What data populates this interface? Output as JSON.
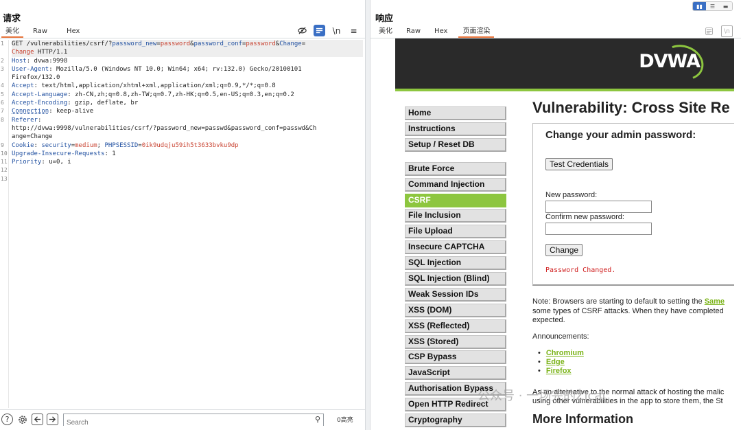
{
  "request": {
    "title": "请求",
    "tabs": [
      "美化",
      "Raw",
      "Hex"
    ],
    "active_tab": "美化",
    "toolbar": {
      "wrap_label": "\\n",
      "menu_label": "≡"
    },
    "lines": [
      {
        "n": "1",
        "parts": [
          {
            "t": "GET /vulnerabilities/csrf/?",
            "c": ""
          },
          {
            "t": "password_new",
            "c": "v"
          },
          {
            "t": "=",
            "c": ""
          },
          {
            "t": "password",
            "c": "p"
          },
          {
            "t": "&",
            "c": ""
          },
          {
            "t": "password_conf",
            "c": "v"
          },
          {
            "t": "=",
            "c": ""
          },
          {
            "t": "password",
            "c": "p"
          },
          {
            "t": "&",
            "c": ""
          },
          {
            "t": "Change",
            "c": "v"
          },
          {
            "t": "=",
            "c": ""
          }
        ]
      },
      {
        "n": "",
        "parts": [
          {
            "t": "Change",
            "c": "p"
          },
          {
            "t": " HTTP/1.1",
            "c": ""
          }
        ]
      },
      {
        "n": "2",
        "parts": [
          {
            "t": "Host",
            "c": "k"
          },
          {
            "t": ": dvwa:9998",
            "c": ""
          }
        ]
      },
      {
        "n": "3",
        "parts": [
          {
            "t": "User-Agent",
            "c": "k"
          },
          {
            "t": ": Mozilla/5.0 (Windows NT 10.0; Win64; x64; rv:132.0) Gecko/20100101",
            "c": ""
          }
        ]
      },
      {
        "n": "",
        "parts": [
          {
            "t": "Firefox/132.0",
            "c": ""
          }
        ]
      },
      {
        "n": "4",
        "parts": [
          {
            "t": "Accept",
            "c": "k"
          },
          {
            "t": ": text/html,application/xhtml+xml,application/xml;q=0.9,*/*;q=0.8",
            "c": ""
          }
        ]
      },
      {
        "n": "5",
        "parts": [
          {
            "t": "Accept-Language",
            "c": "k"
          },
          {
            "t": ": zh-CN,zh;q=0.8,zh-TW;q=0.7,zh-HK;q=0.5,en-US;q=0.3,en;q=0.2",
            "c": ""
          }
        ]
      },
      {
        "n": "6",
        "parts": [
          {
            "t": "Accept-Encoding",
            "c": "k"
          },
          {
            "t": ": gzip, deflate, br",
            "c": ""
          }
        ]
      },
      {
        "n": "7",
        "parts": [
          {
            "t": "Connection",
            "c": "k"
          },
          {
            "t": ": keep-alive",
            "c": ""
          }
        ]
      },
      {
        "n": "8",
        "parts": [
          {
            "t": "Referer",
            "c": "k"
          },
          {
            "t": ":",
            "c": ""
          }
        ]
      },
      {
        "n": "",
        "parts": [
          {
            "t": "http://dvwa:9998/vulnerabilities/csrf/?password_new=passwd&password_conf=passwd&Ch",
            "c": ""
          }
        ]
      },
      {
        "n": "",
        "parts": [
          {
            "t": "ange=Change",
            "c": ""
          }
        ]
      },
      {
        "n": "9",
        "parts": [
          {
            "t": "Cookie",
            "c": "k"
          },
          {
            "t": ": ",
            "c": ""
          },
          {
            "t": "security",
            "c": "v"
          },
          {
            "t": "=",
            "c": ""
          },
          {
            "t": "medium",
            "c": "p"
          },
          {
            "t": "; ",
            "c": ""
          },
          {
            "t": "PHPSESSID",
            "c": "v"
          },
          {
            "t": "=",
            "c": ""
          },
          {
            "t": "0ik9udqju59ih5t3633bvku9dp",
            "c": "p"
          }
        ]
      },
      {
        "n": "10",
        "parts": [
          {
            "t": "Upgrade-Insecure-Requests",
            "c": "k"
          },
          {
            "t": ": 1",
            "c": ""
          }
        ]
      },
      {
        "n": "11",
        "parts": [
          {
            "t": "Priority",
            "c": "k"
          },
          {
            "t": ": u=0, i",
            "c": ""
          }
        ]
      },
      {
        "n": "12",
        "parts": []
      },
      {
        "n": "13",
        "parts": []
      }
    ],
    "search_placeholder": "Search",
    "highlight_count": "0高亮"
  },
  "response": {
    "title": "响应",
    "tabs": [
      "美化",
      "Raw",
      "Hex",
      "页面渲染"
    ],
    "active_tab": "页面渲染",
    "toolbar": {
      "wrap_label": "\\n",
      "menu_label": "≡"
    },
    "view_toggle": [
      "▮▮",
      "☰",
      "▬"
    ],
    "dvwa": {
      "logo": "DVWA",
      "menu": [
        {
          "label": "Home",
          "active": false,
          "gap": false
        },
        {
          "label": "Instructions",
          "active": false,
          "gap": false
        },
        {
          "label": "Setup / Reset DB",
          "active": false,
          "gap": false
        },
        {
          "label": "Brute Force",
          "active": false,
          "gap": true
        },
        {
          "label": "Command Injection",
          "active": false,
          "gap": false
        },
        {
          "label": "CSRF",
          "active": true,
          "gap": false
        },
        {
          "label": "File Inclusion",
          "active": false,
          "gap": false
        },
        {
          "label": "File Upload",
          "active": false,
          "gap": false
        },
        {
          "label": "Insecure CAPTCHA",
          "active": false,
          "gap": false
        },
        {
          "label": "SQL Injection",
          "active": false,
          "gap": false
        },
        {
          "label": "SQL Injection (Blind)",
          "active": false,
          "gap": false
        },
        {
          "label": "Weak Session IDs",
          "active": false,
          "gap": false
        },
        {
          "label": "XSS (DOM)",
          "active": false,
          "gap": false
        },
        {
          "label": "XSS (Reflected)",
          "active": false,
          "gap": false
        },
        {
          "label": "XSS (Stored)",
          "active": false,
          "gap": false
        },
        {
          "label": "CSP Bypass",
          "active": false,
          "gap": false
        },
        {
          "label": "JavaScript",
          "active": false,
          "gap": false
        },
        {
          "label": "Authorisation Bypass",
          "active": false,
          "gap": false
        },
        {
          "label": "Open HTTP Redirect",
          "active": false,
          "gap": false
        },
        {
          "label": "Cryptography",
          "active": false,
          "gap": false
        }
      ],
      "heading": "Vulnerability: Cross Site Re",
      "box_title": "Change your admin password:",
      "test_button": "Test Credentials",
      "new_password_label": "New password:",
      "confirm_password_label": "Confirm new password:",
      "change_button": "Change",
      "message": "Password Changed.",
      "note_prefix": "Note: Browsers are starting to default to setting the ",
      "note_link": "Same",
      "note_rest": "some types of CSRF attacks. When they have completed",
      "note_end": "expected.",
      "announcements": "Announcements:",
      "links": [
        "Chromium",
        "Edge",
        "Firefox"
      ],
      "para2_line1": "As an alternative to the normal attack of hosting the malic",
      "para2_line2": "using other vulnerabilities in the app to store them, the St",
      "more_info": "More Information"
    },
    "watermark": "公众号 · 一场完的Zicai"
  }
}
